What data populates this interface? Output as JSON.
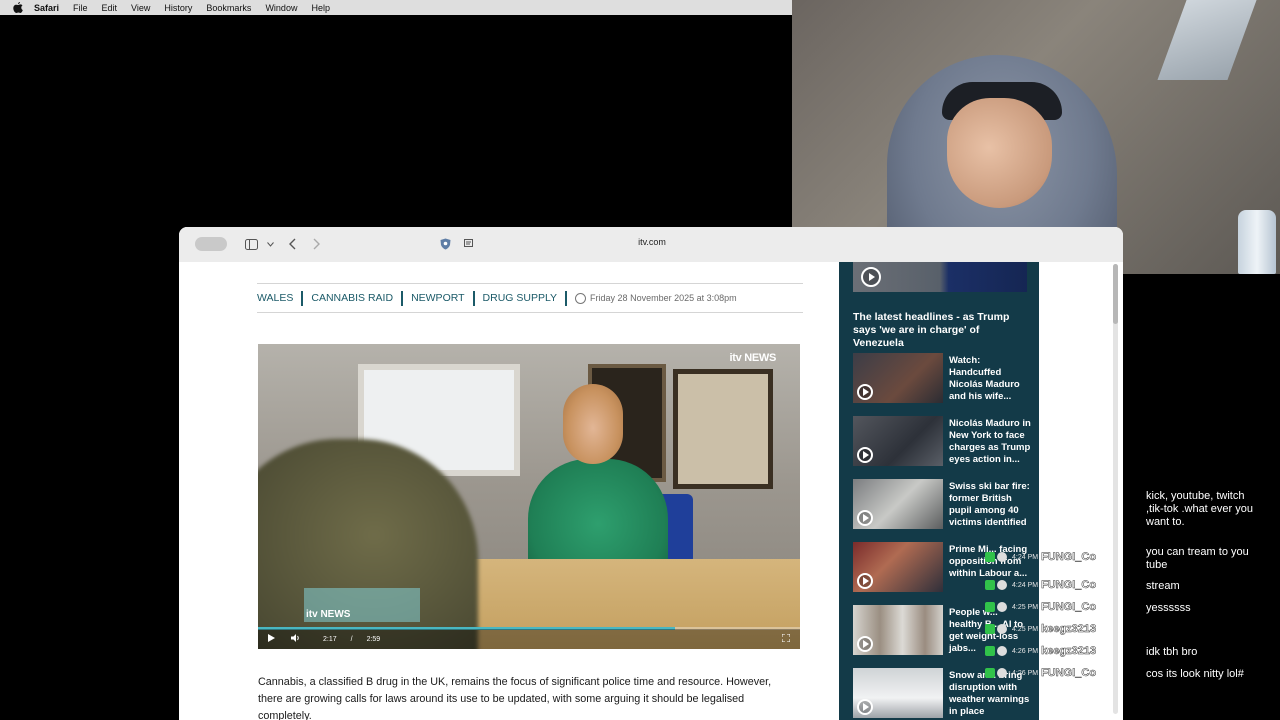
{
  "menubar": {
    "app_name": "Safari",
    "items": [
      "File",
      "Edit",
      "View",
      "History",
      "Bookmarks",
      "Window",
      "Help"
    ]
  },
  "browser": {
    "url": "itv.com"
  },
  "article": {
    "tags": [
      "WALES",
      "CANNABIS RAID",
      "NEWPORT",
      "DRUG SUPPLY"
    ],
    "date": "Friday 28 November 2025 at 3:08pm",
    "video": {
      "logo": "itv NEWS",
      "lower_logo": "itv NEWS",
      "current_time": "2:17",
      "separator": "/",
      "duration": "2:59",
      "progress": 0.77
    },
    "body": "Cannabis, a classified B drug in the UK, remains the focus of significant police time and resource. However, there are growing calls for laws around its use to be updated, with some arguing it should be legalised completely."
  },
  "sidebar": {
    "headline": "The latest headlines - as Trump says 'we are in charge' of Venezuela",
    "stories": [
      {
        "title": "Watch: Handcuffed Nicolás Maduro and his wife..."
      },
      {
        "title": "Nicolás Maduro in New York to face charges as Trump eyes action in..."
      },
      {
        "title": "Swiss ski bar fire: former British pupil among 40 victims identified"
      },
      {
        "title": "Prime Mi... facing opposition from within Labour a..."
      },
      {
        "title": "People w... healthy B... AI to get weight-loss jabs..."
      },
      {
        "title": "Snow an... bring disruption with weather warnings in place"
      }
    ]
  },
  "chat": {
    "events": [
      {
        "time": "4:24 PM",
        "user": "FUNGI_Co"
      },
      {
        "time": "4:24 PM",
        "user": "FUNGI_Co"
      },
      {
        "time": "4:25 PM",
        "user": "FUNGI_Co"
      },
      {
        "time": "4:25 PM",
        "user": "keegz3213"
      },
      {
        "time": "4:26 PM",
        "user": "keegz3213"
      },
      {
        "time": "4:26 PM",
        "user": "FUNGI_Co"
      }
    ],
    "messages": [
      "kick, youtube, twitch ,tik-tok .what ever you want to.",
      "you can tream to you tube",
      "stream",
      "yessssss",
      "idk tbh bro",
      "cos its look nitty lol#"
    ]
  },
  "colors": {
    "itv_teal": "#1b5a68",
    "sidebar_bg": "#133a48",
    "progress": "#49b7c2"
  }
}
